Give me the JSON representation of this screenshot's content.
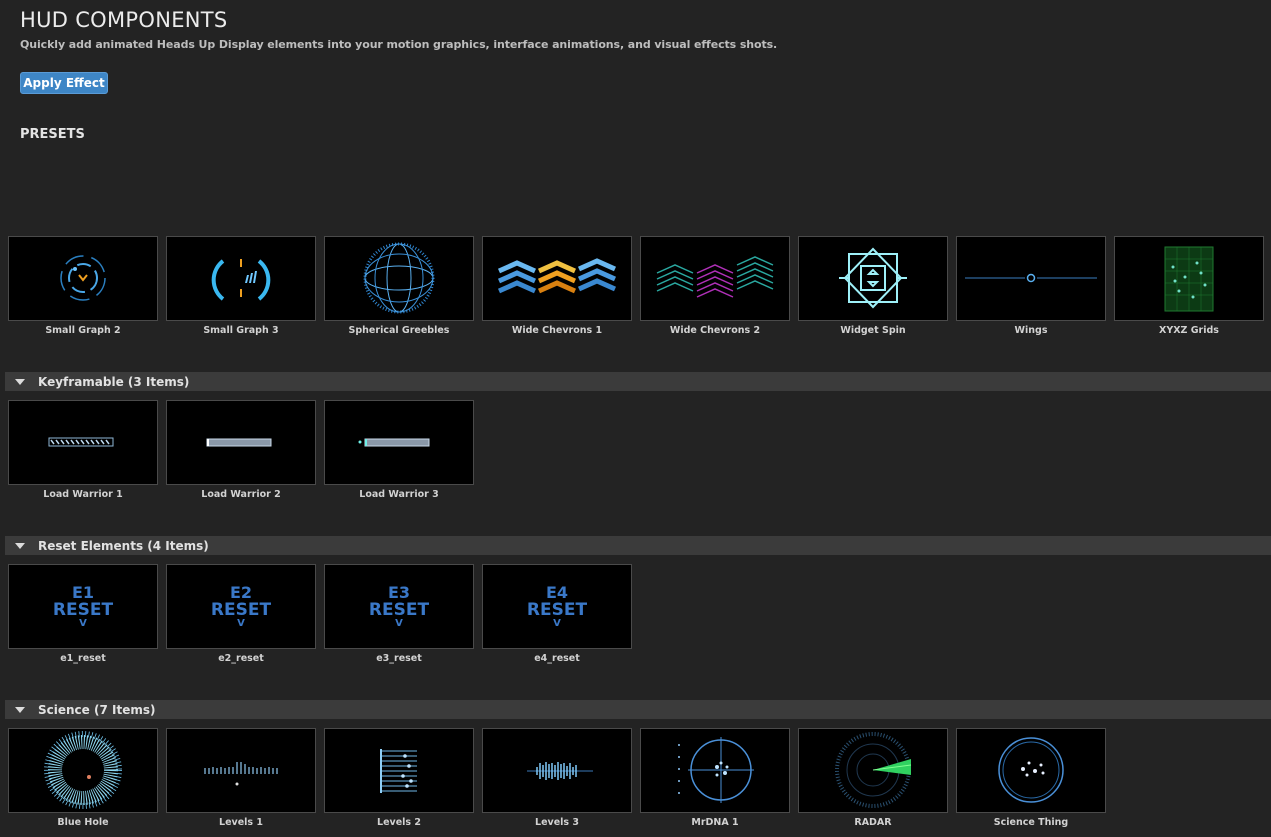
{
  "header": {
    "title": "HUD COMPONENTS",
    "subtitle": "Quickly add animated Heads Up Display elements into your motion graphics, interface animations, and visual effects shots.",
    "apply_label": "Apply Effect",
    "presets_label": "PRESETS"
  },
  "top_row": [
    {
      "label": "Small Graph 2"
    },
    {
      "label": "Small Graph 3"
    },
    {
      "label": "Spherical Greebles"
    },
    {
      "label": "Wide Chevrons 1"
    },
    {
      "label": "Wide Chevrons 2"
    },
    {
      "label": "Widget Spin"
    },
    {
      "label": "Wings"
    },
    {
      "label": "XYXZ Grids"
    }
  ],
  "groups": [
    {
      "label": "Keyframable (3 Items)",
      "items": [
        {
          "label": "Load Warrior 1"
        },
        {
          "label": "Load Warrior 2"
        },
        {
          "label": "Load Warrior 3"
        }
      ]
    },
    {
      "label": "Reset Elements (4 Items)",
      "items": [
        {
          "label": "e1_reset",
          "code": "E1",
          "word": "RESET",
          "mark": "V"
        },
        {
          "label": "e2_reset",
          "code": "E2",
          "word": "RESET",
          "mark": "V"
        },
        {
          "label": "e3_reset",
          "code": "E3",
          "word": "RESET",
          "mark": "V"
        },
        {
          "label": "e4_reset",
          "code": "E4",
          "word": "RESET",
          "mark": "V"
        }
      ]
    },
    {
      "label": "Science (7 Items)",
      "items": [
        {
          "label": "Blue Hole"
        },
        {
          "label": "Levels 1"
        },
        {
          "label": "Levels 2"
        },
        {
          "label": "Levels 3"
        },
        {
          "label": "MrDNA 1"
        },
        {
          "label": "RADAR"
        },
        {
          "label": "Science Thing"
        }
      ]
    }
  ]
}
